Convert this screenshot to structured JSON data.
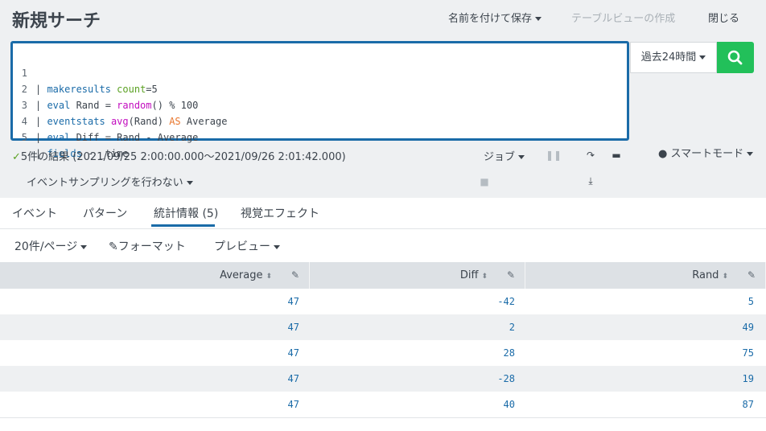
{
  "header": {
    "title": "新規サーチ",
    "save_as": "名前を付けて保存",
    "create_table_view": "テーブルビューの作成",
    "close": "閉じる"
  },
  "editor": {
    "lines": [
      {
        "num": "1",
        "parts": [
          "| ",
          "makeresults",
          " ",
          "count",
          "=5"
        ]
      },
      {
        "num": "2",
        "parts": [
          "| ",
          "eval",
          " Rand = ",
          "random",
          "() % 100"
        ]
      },
      {
        "num": "3",
        "parts": [
          "| ",
          "eventstats",
          " ",
          "avg",
          "(Rand) ",
          "AS",
          " Average"
        ]
      },
      {
        "num": "4",
        "parts": [
          "| ",
          "eval",
          " Diff = Rand - Average"
        ]
      },
      {
        "num": "5",
        "parts": [
          "| ",
          "fields",
          " - _time"
        ]
      }
    ]
  },
  "time_picker": {
    "label": "過去24時間"
  },
  "status": {
    "results": "5件の結果 (2021/09/25 2:00:00.000〜2021/09/26 2:01:42.000)",
    "sampling": "イベントサンプリングを行わない",
    "job": "ジョブ",
    "mode": "スマートモード"
  },
  "tabs": [
    {
      "label": "イベント"
    },
    {
      "label": "パターン"
    },
    {
      "label": "統計情報 (5)"
    },
    {
      "label": "視覚エフェクト"
    }
  ],
  "toolbar": {
    "per_page": "20件/ページ",
    "format": "フォーマット",
    "preview": "プレビュー"
  },
  "table": {
    "columns": [
      "Average",
      "Diff",
      "Rand"
    ],
    "rows": [
      [
        "47",
        "-42",
        "5"
      ],
      [
        "47",
        "2",
        "49"
      ],
      [
        "47",
        "28",
        "75"
      ],
      [
        "47",
        "-28",
        "19"
      ],
      [
        "47",
        "40",
        "87"
      ]
    ]
  },
  "colors": {
    "accent": "#1a6ba8",
    "search_button": "#22c05a",
    "success": "#5ba123"
  },
  "icons": [
    "search-icon",
    "pause-icon",
    "stop-icon",
    "share-icon",
    "print-icon",
    "export-icon",
    "lightbulb-icon",
    "check-icon",
    "pencil-icon",
    "sort-icon"
  ]
}
